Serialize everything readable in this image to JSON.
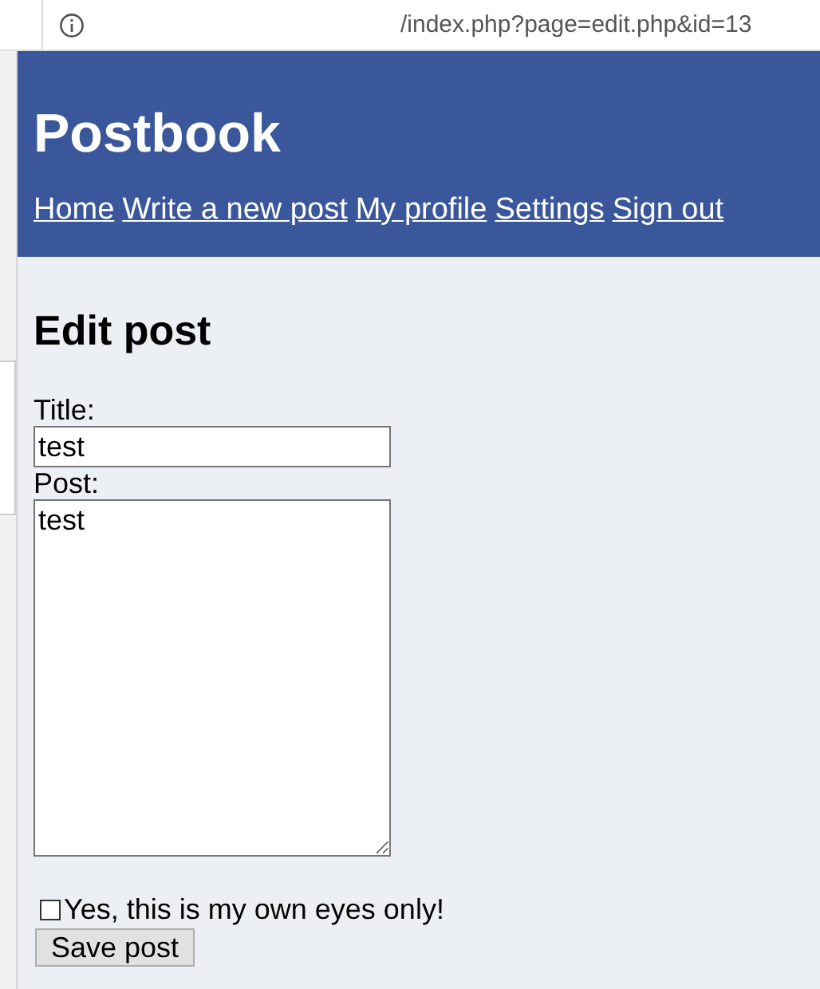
{
  "address_bar": {
    "url": "/index.php?page=edit.php&id=13"
  },
  "header": {
    "title": "Postbook",
    "nav": [
      {
        "label": "Home"
      },
      {
        "label": "Write a new post"
      },
      {
        "label": "My profile"
      },
      {
        "label": "Settings"
      },
      {
        "label": "Sign out"
      }
    ]
  },
  "form": {
    "heading": "Edit post",
    "title_label": "Title:",
    "title_value": "test",
    "post_label": "Post:",
    "post_value": "test",
    "private": {
      "label": "Yes, this is my own eyes only!",
      "checked": false
    },
    "submit": "Save post"
  }
}
